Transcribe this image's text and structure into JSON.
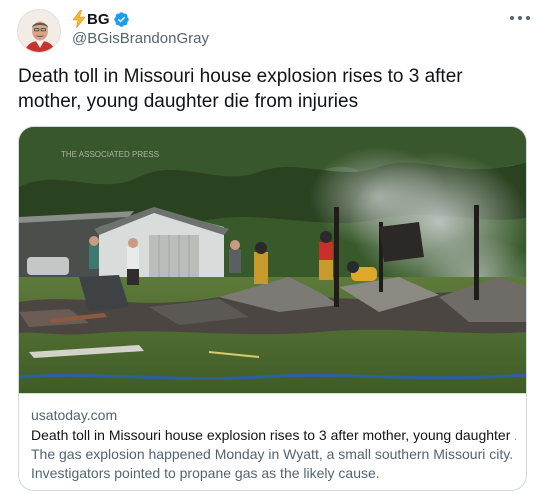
{
  "author": {
    "display_name": "BG",
    "handle": "@BGisBrandonGray",
    "verified": true,
    "name_prefix_icon": "lightning-bolt-icon",
    "avatar_icon": "avatar-portrait"
  },
  "tweet": {
    "text": "Death toll in Missouri house explosion rises to 3 after mother, young daughter die from injuries"
  },
  "card": {
    "image_watermark": "THE ASSOCIATED PRESS",
    "domain": "usatoday.com",
    "title": "Death toll in Missouri house explosion rises to 3 after mother, young daughter ...",
    "description": "The gas explosion happened Monday in Wyatt, a small southern Missouri city. Investigators pointed to propane gas as the likely cause."
  },
  "colors": {
    "text_primary": "#0f1419",
    "text_secondary": "#536471",
    "border": "#cfd9de",
    "verified_blue": "#1d9bf0",
    "bolt": "#f5b82e"
  }
}
